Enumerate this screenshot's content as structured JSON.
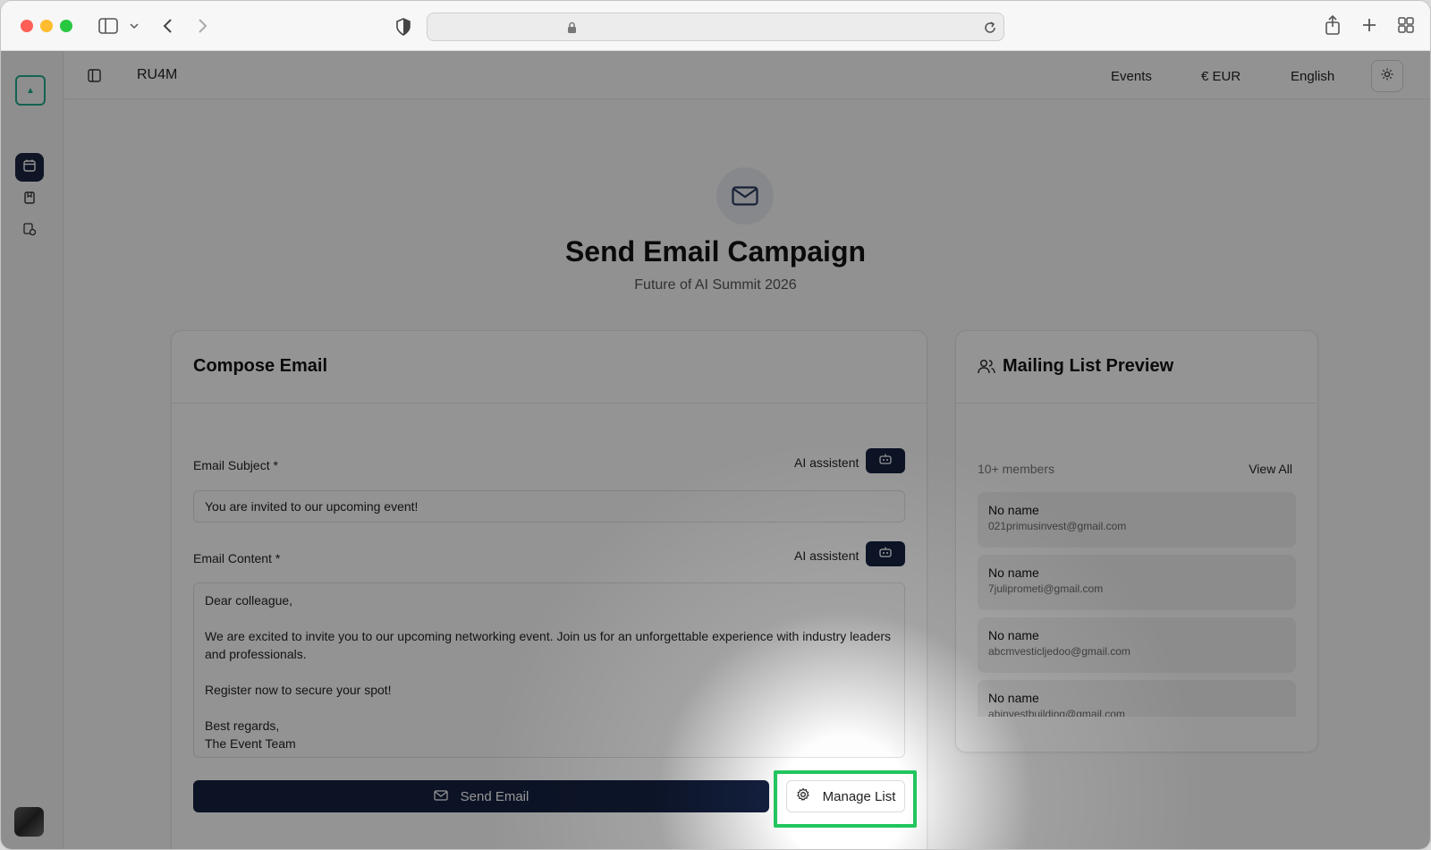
{
  "app": {
    "name": "RU4M"
  },
  "topbar": {
    "events_label": "Events",
    "currency_label": "€ EUR",
    "language_label": "English"
  },
  "page": {
    "title": "Send Email Campaign",
    "subtitle": "Future of AI Summit 2026"
  },
  "compose": {
    "title": "Compose Email",
    "subject_label": "Email Subject *",
    "subject_value": "You are invited to our upcoming event!",
    "content_label": "Email Content *",
    "content_value": "Dear colleague,\n\nWe are excited to invite you to our upcoming networking event. Join us for an unforgettable experience with industry leaders and professionals.\n\nRegister now to secure your spot!\n\nBest regards,\nThe Event Team",
    "ai_assistant_label": "AI assistent",
    "send_label": "Send Email",
    "manage_label": "Manage List"
  },
  "mailing": {
    "title": "Mailing List Preview",
    "count_label": "10+ members",
    "view_all_label": "View All",
    "members": [
      {
        "name": "No name",
        "email": "021primusinvest@gmail.com"
      },
      {
        "name": "No name",
        "email": "7juliprometi@gmail.com"
      },
      {
        "name": "No name",
        "email": "abcmvesticljedoo@gmail.com"
      },
      {
        "name": "No name",
        "email": "abinvestbuilding@gmail.com"
      }
    ]
  },
  "colors": {
    "primary": "#13203f",
    "highlight": "#22c55e",
    "brand_teal": "#22a98e"
  }
}
